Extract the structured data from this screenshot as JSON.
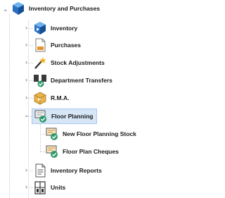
{
  "tree": {
    "root": {
      "label": "Inventory and Purchases",
      "icon": "cube-icon"
    },
    "items": [
      {
        "label": "Inventory",
        "icon": "cube-arrow-icon"
      },
      {
        "label": "Purchases",
        "icon": "purchase-document-icon"
      },
      {
        "label": "Stock Adjustments",
        "icon": "wand-star-icon"
      },
      {
        "label": "Department Transfers",
        "icon": "transfer-icon"
      },
      {
        "label": "R.M.A.",
        "icon": "return-box-icon"
      },
      {
        "label": "Floor Planning",
        "icon": "floor-planning-icon",
        "selected": true
      },
      {
        "label": "Inventory Reports",
        "icon": "report-document-icon"
      },
      {
        "label": "Units",
        "icon": "units-icon"
      }
    ],
    "floor_children": [
      {
        "label": "New Floor Planning Stock",
        "icon": "floor-planning-stock-icon"
      },
      {
        "label": "Floor Plan Cheques",
        "icon": "floor-plan-cheques-icon"
      }
    ]
  }
}
